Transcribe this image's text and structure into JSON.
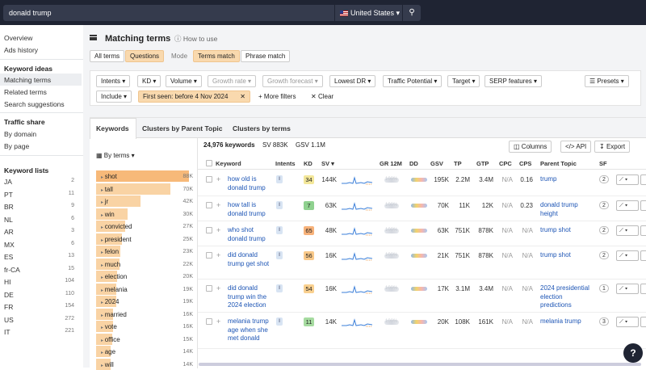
{
  "topbar": {
    "query": "donald trump",
    "country": "United States"
  },
  "sidebar": {
    "overview": "Overview",
    "ads_history": "Ads history",
    "keyword_ideas": "Keyword ideas",
    "matching_terms": "Matching terms",
    "related_terms": "Related terms",
    "search_suggestions": "Search suggestions",
    "traffic_share": "Traffic share",
    "by_domain": "By domain",
    "by_page": "By page",
    "keyword_lists": "Keyword lists",
    "lists": [
      {
        "name": "JA",
        "count": "2"
      },
      {
        "name": "PT",
        "count": "11"
      },
      {
        "name": "BR",
        "count": "9"
      },
      {
        "name": "NL",
        "count": "6"
      },
      {
        "name": "AR",
        "count": "3"
      },
      {
        "name": "MX",
        "count": "6"
      },
      {
        "name": "ES",
        "count": "13"
      },
      {
        "name": "fr-CA",
        "count": "15"
      },
      {
        "name": "HI",
        "count": "104"
      },
      {
        "name": "DE",
        "count": "110"
      },
      {
        "name": "FR",
        "count": "154"
      },
      {
        "name": "US",
        "count": "272"
      },
      {
        "name": "IT",
        "count": "221"
      }
    ]
  },
  "header": {
    "title": "Matching terms",
    "how_to": "How to use"
  },
  "mode_bar": {
    "all_terms": "All terms",
    "questions": "Questions",
    "mode": "Mode",
    "terms_match": "Terms match",
    "phrase_match": "Phrase match"
  },
  "filters": {
    "intents": "Intents",
    "kd": "KD",
    "volume": "Volume",
    "growth_rate": "Growth rate",
    "growth_forecast": "Growth forecast",
    "lowest_dr": "Lowest DR",
    "traffic_potential": "Traffic Potential",
    "target": "Target",
    "serp_features": "SERP features",
    "presets": "Presets",
    "include": "Include",
    "first_seen": "First seen: before 4 Nov 2024",
    "more_filters": "More filters",
    "clear": "Clear"
  },
  "tabs": {
    "keywords": "Keywords",
    "clusters_parent": "Clusters by Parent Topic",
    "clusters_terms": "Clusters by terms"
  },
  "terms_panel": {
    "by_terms": "By terms",
    "terms": [
      {
        "term": "shot",
        "count": "88K",
        "level": 1.0
      },
      {
        "term": "tall",
        "count": "70K",
        "level": 0.8
      },
      {
        "term": "jr",
        "count": "42K",
        "level": 0.48
      },
      {
        "term": "win",
        "count": "30K",
        "level": 0.34
      },
      {
        "term": "convicted",
        "count": "27K",
        "level": 0.31
      },
      {
        "term": "president",
        "count": "25K",
        "level": 0.28
      },
      {
        "term": "felon",
        "count": "23K",
        "level": 0.26
      },
      {
        "term": "much",
        "count": "22K",
        "level": 0.25
      },
      {
        "term": "election",
        "count": "20K",
        "level": 0.23
      },
      {
        "term": "melania",
        "count": "19K",
        "level": 0.22
      },
      {
        "term": "2024",
        "count": "19K",
        "level": 0.22
      },
      {
        "term": "married",
        "count": "16K",
        "level": 0.18
      },
      {
        "term": "vote",
        "count": "16K",
        "level": 0.18
      },
      {
        "term": "office",
        "count": "15K",
        "level": 0.17
      },
      {
        "term": "age",
        "count": "14K",
        "level": 0.16
      },
      {
        "term": "will",
        "count": "14K",
        "level": 0.16
      }
    ]
  },
  "summary": {
    "keywords": "24,976 keywords",
    "sv": "SV 883K",
    "gsv": "GSV 1.1M",
    "columns": "Columns",
    "api": "API",
    "export": "Export"
  },
  "columns": [
    "Keyword",
    "Intents",
    "KD",
    "SV",
    "GR 12M",
    "DD",
    "GSV",
    "TP",
    "GTP",
    "CPC",
    "CPS",
    "Parent Topic",
    "SF"
  ],
  "rows": [
    {
      "keyword": "how old is donald trump",
      "intent": "I",
      "kd": "34",
      "kd_color": "#f3e79a",
      "sv": "144K",
      "gr": "100%",
      "gsv": "195K",
      "tp": "2.2M",
      "gtp": "3.4M",
      "cpc": "N/A",
      "cps": "0.16",
      "parent": "trump",
      "sf": "2"
    },
    {
      "keyword": "how tall is donald trump",
      "intent": "I",
      "kd": "7",
      "kd_color": "#8fd18f",
      "sv": "63K",
      "gr": "100%",
      "gsv": "70K",
      "tp": "11K",
      "gtp": "12K",
      "cpc": "N/A",
      "cps": "0.23",
      "parent": "donald trump height",
      "sf": "2"
    },
    {
      "keyword": "who shot donald trump",
      "intent": "I",
      "kd": "65",
      "kd_color": "#f7b27a",
      "sv": "48K",
      "gr": "100%",
      "gsv": "63K",
      "tp": "751K",
      "gtp": "878K",
      "cpc": "N/A",
      "cps": "N/A",
      "parent": "trump shot",
      "sf": "2"
    },
    {
      "keyword": "did donald trump get shot",
      "intent": "I",
      "kd": "56",
      "kd_color": "#f9c98a",
      "sv": "16K",
      "gr": "100%",
      "gsv": "21K",
      "tp": "751K",
      "gtp": "878K",
      "cpc": "N/A",
      "cps": "N/A",
      "parent": "trump shot",
      "sf": "2"
    },
    {
      "keyword": "did donald trump win the 2024 election",
      "intent": "I",
      "kd": "54",
      "kd_color": "#f9d08f",
      "sv": "16K",
      "gr": "100%",
      "gsv": "17K",
      "tp": "3.1M",
      "gtp": "3.4M",
      "cpc": "N/A",
      "cps": "N/A",
      "parent": "2024 presidential election predictions",
      "sf": "1"
    },
    {
      "keyword": "melania trump age when she met donald",
      "intent": "I",
      "kd": "11",
      "kd_color": "#a6dba0",
      "sv": "14K",
      "gr": "100%",
      "gsv": "20K",
      "tp": "108K",
      "gtp": "161K",
      "cpc": "N/A",
      "cps": "N/A",
      "parent": "melania trump",
      "sf": "3"
    }
  ],
  "colors": {
    "topbar": "#1f2433",
    "accent_orange": "#f9d9ae",
    "link_blue": "#1d55b5"
  }
}
